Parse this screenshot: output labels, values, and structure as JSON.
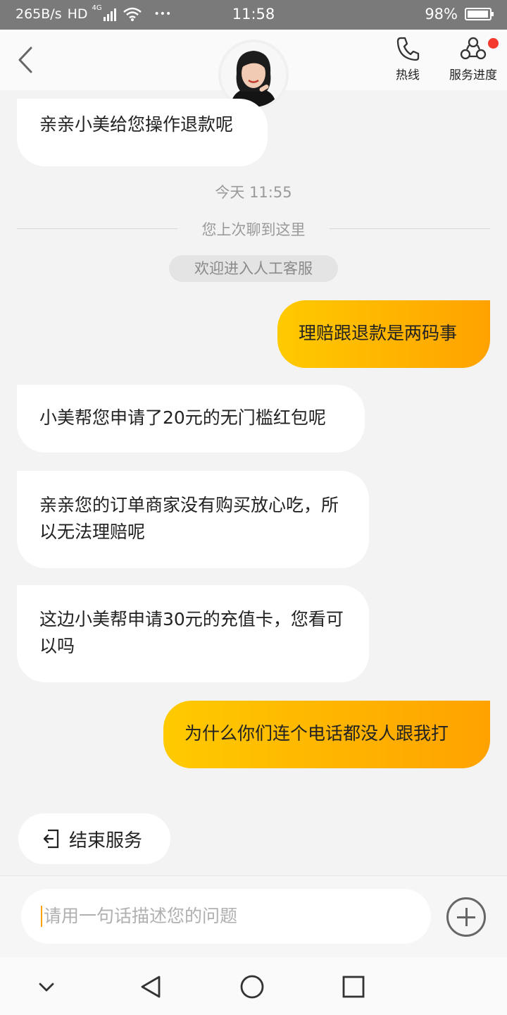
{
  "status_bar": {
    "speed": "265B/s",
    "hd": "HD",
    "network": "4G",
    "more": "•••",
    "time": "11:58",
    "battery": "98%",
    "battery_level": 0.98
  },
  "header": {
    "hotline_label": "热线",
    "progress_label": "服务进度",
    "icons": [
      "back-chevron-icon",
      "phone-icon",
      "service-progress-icon"
    ]
  },
  "chat": {
    "msg1": "亲亲小美给您操作退款呢",
    "time_label": "今天 11:55",
    "divider_text": "您上次聊到这里",
    "system_notice": "欢迎进入人工客服",
    "msg2": "理赔跟退款是两码事",
    "msg3": "小美帮您申请了20元的无门槛红包呢",
    "msg4": "亲亲您的订单商家没有购买放心吃，所以无法理赔呢",
    "msg5": "这边小美帮申请30元的充值卡，您看可以吗",
    "msg6": "为什么你们连个电话都没人跟我打"
  },
  "end_service_label": "结束服务",
  "input": {
    "placeholder": "请用一句话描述您的问题"
  },
  "colors": {
    "user_bubble_start": "#ffca00",
    "user_bubble_end": "#ffa200",
    "notification_dot": "#f43a2c"
  }
}
